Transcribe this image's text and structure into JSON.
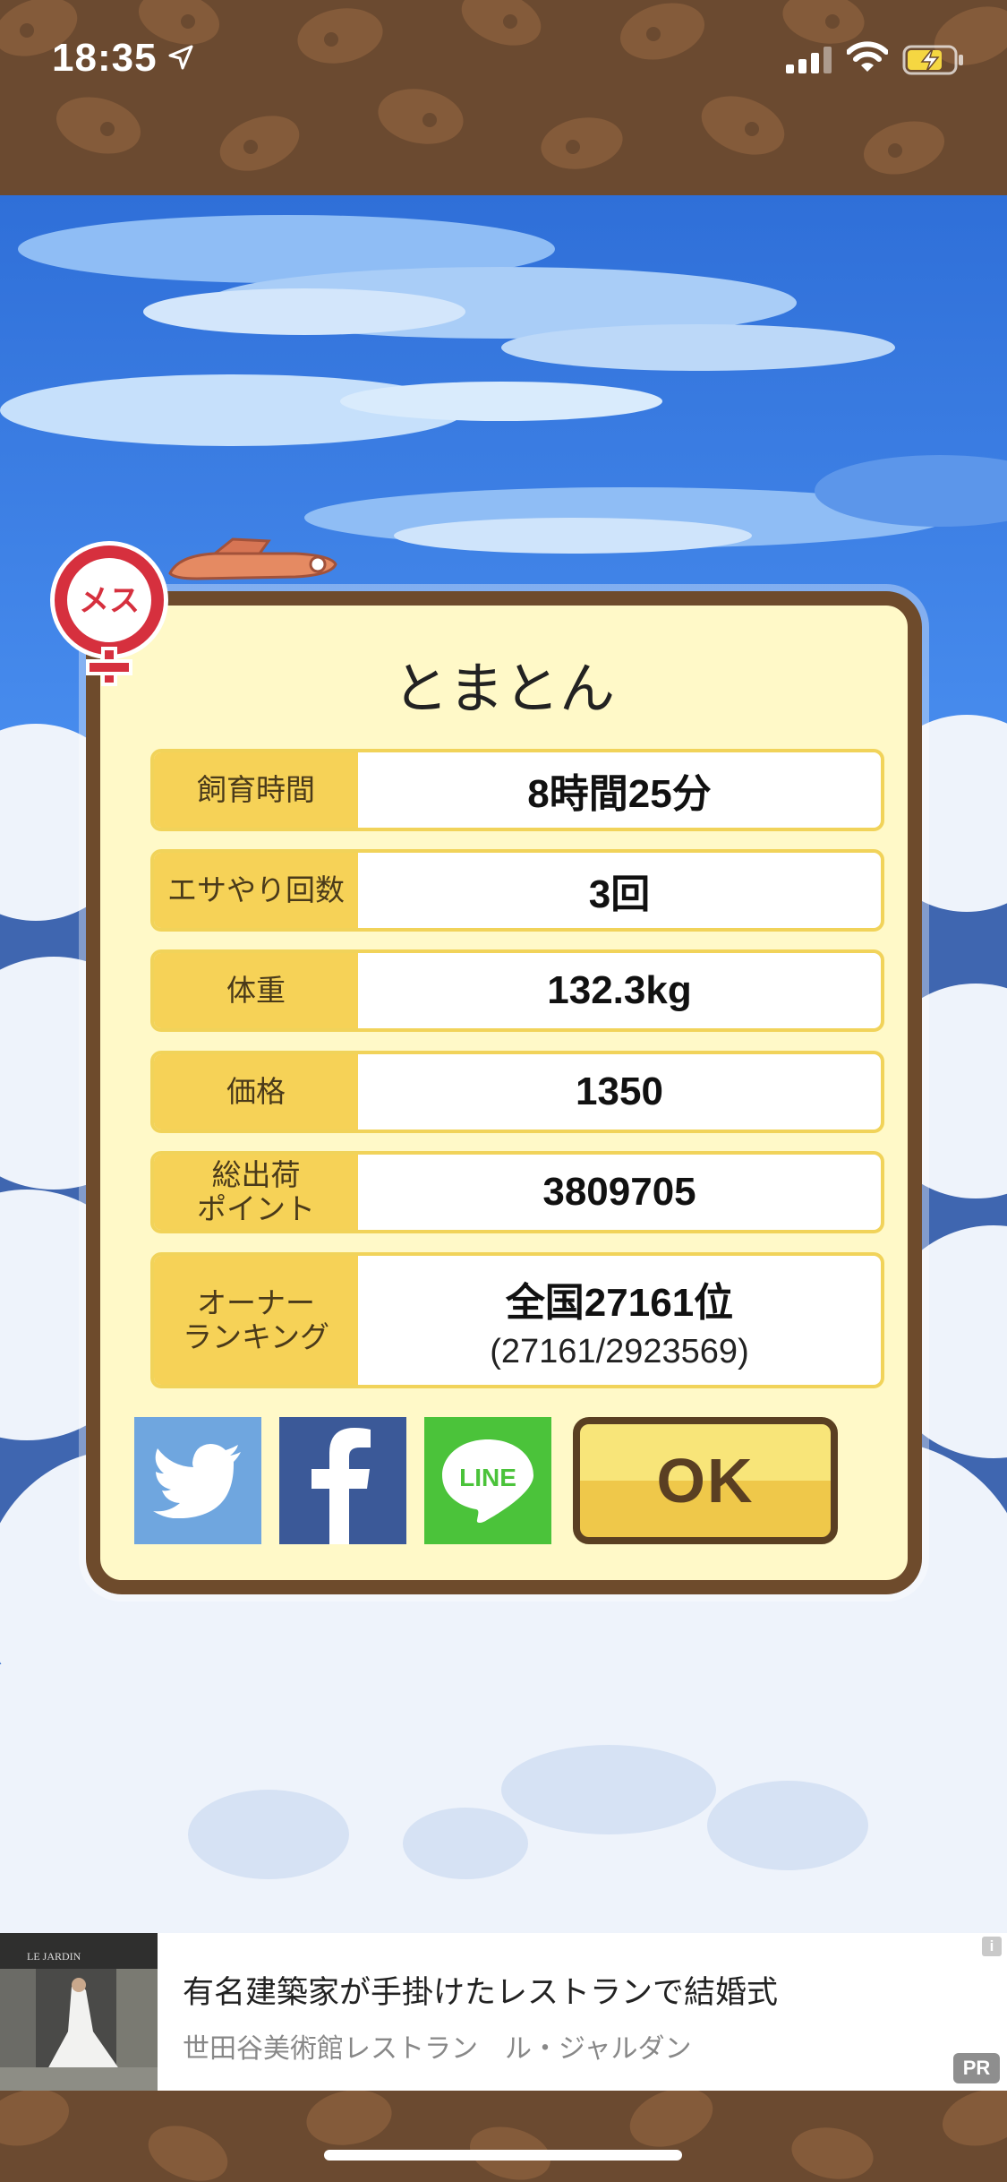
{
  "status_bar": {
    "time": "18:35",
    "icons": [
      "location-arrow-icon",
      "cellular-signal-icon",
      "wifi-icon",
      "battery-charging-icon"
    ]
  },
  "colors": {
    "brown_frame": "#6e4b2c",
    "dialog_bg": "#fff9c8",
    "label_bg": "#f6d257",
    "sky_blue": "#3f7fe0",
    "twitter": "#6fa6df",
    "facebook": "#3b5998",
    "line": "#4bc33a",
    "ok_button": "#f8e579"
  },
  "pig_profile": {
    "gender_badge": "メス",
    "name": "とまとん",
    "stats": [
      {
        "label": "飼育時間",
        "value": "8時間25分"
      },
      {
        "label": "エサやり回数",
        "value": "3回"
      },
      {
        "label": "体重",
        "value": "132.3kg"
      },
      {
        "label": "価格",
        "value": "1350"
      },
      {
        "label": "総出荷\nポイント",
        "value": "3809705"
      },
      {
        "label": "オーナー\nランキング",
        "value": "全国27161位",
        "sub_value": "(27161/2923569)"
      }
    ]
  },
  "share_buttons": {
    "twitter_icon": "twitter-bird-icon",
    "facebook_icon": "facebook-f-icon",
    "line_label": "LINE"
  },
  "ok_button": {
    "label": "OK"
  },
  "ad_banner": {
    "title": "有名建築家が手掛けたレストランで結婚式",
    "subtitle": "世田谷美術館レストラン　ル・ジャルダン",
    "info": "i",
    "pr_label": "PR",
    "image_text": "LE JARDIN"
  }
}
